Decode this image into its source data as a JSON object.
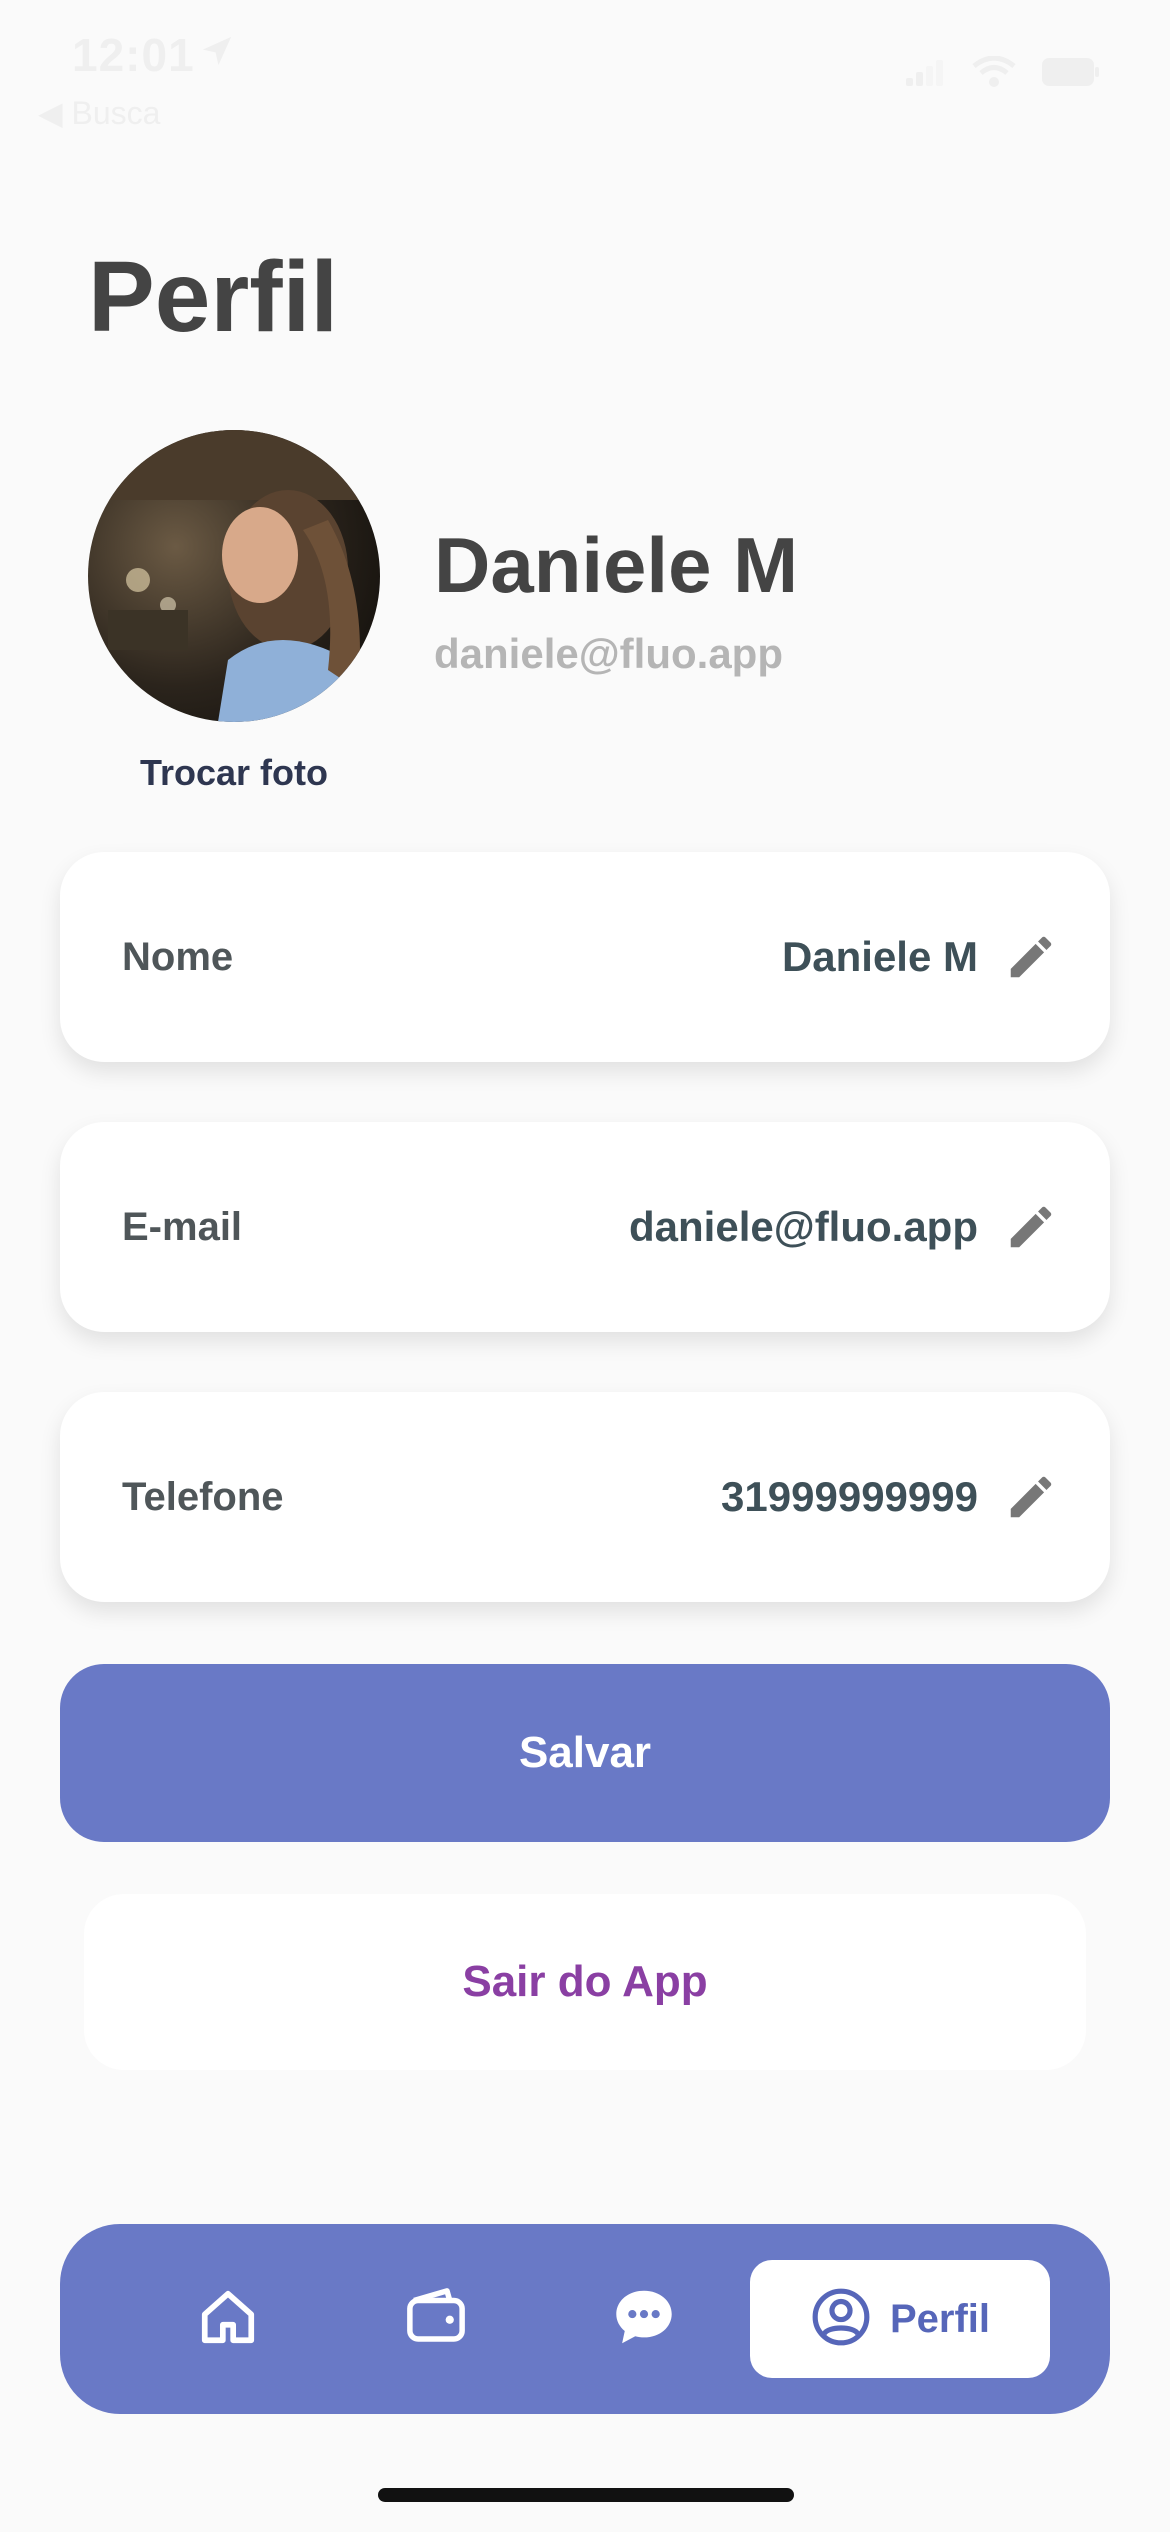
{
  "status_bar": {
    "time": "12:01",
    "back_label": "◀ Busca"
  },
  "page": {
    "title": "Perfil"
  },
  "profile": {
    "name": "Daniele M",
    "email": "daniele@fluo.app",
    "change_photo_label": "Trocar foto"
  },
  "fields": [
    {
      "label": "Nome",
      "value": "Daniele M"
    },
    {
      "label": "E-mail",
      "value": "daniele@fluo.app"
    },
    {
      "label": "Telefone",
      "value": "31999999999"
    }
  ],
  "actions": {
    "save_label": "Salvar",
    "logout_label": "Sair do App"
  },
  "tab_bar": {
    "tabs": [
      {
        "icon": "home-icon"
      },
      {
        "icon": "wallet-icon"
      },
      {
        "icon": "chat-icon"
      },
      {
        "icon": "user-circle-icon",
        "label": "Perfil",
        "active": true
      }
    ]
  },
  "colors": {
    "accent": "#6979C6",
    "logout": "#8A3FA3",
    "background": "#FAFAFA"
  }
}
